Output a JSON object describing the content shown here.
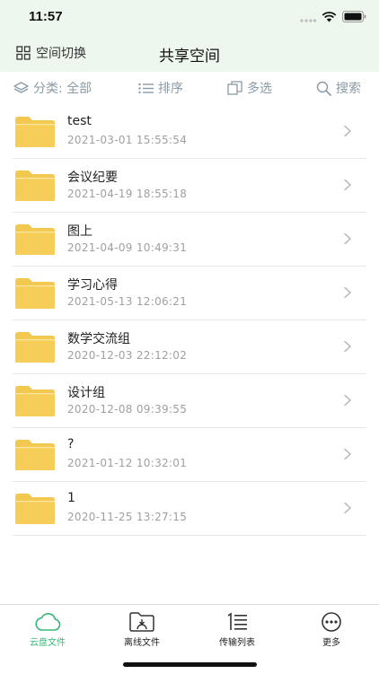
{
  "status": {
    "time": "11:57"
  },
  "nav": {
    "space_switch_label": "空间切换",
    "title": "共享空间"
  },
  "toolbar": {
    "category_label": "分类: 全部",
    "sort_label": "排序",
    "multi_select_label": "多选",
    "search_label": "搜索"
  },
  "files": [
    {
      "name": "test",
      "date": "2021-03-01 15:55:54"
    },
    {
      "name": "会议纪要",
      "date": "2021-04-19 18:55:18"
    },
    {
      "name": "图上",
      "date": "2021-04-09 10:49:31"
    },
    {
      "name": "学习心得",
      "date": "2021-05-13 12:06:21"
    },
    {
      "name": "数学交流组",
      "date": "2020-12-03 22:12:02"
    },
    {
      "name": "设计组",
      "date": "2020-12-08 09:39:55"
    },
    {
      "name": "?",
      "date": "2021-01-12 10:32:01"
    },
    {
      "name": "1",
      "date": "2020-11-25 13:27:15"
    }
  ],
  "tabs": [
    {
      "label": "云盘文件",
      "icon": "cloud-icon",
      "active": true
    },
    {
      "label": "离线文件",
      "icon": "offline-folder-icon",
      "active": false
    },
    {
      "label": "传输列表",
      "icon": "transfer-list-icon",
      "active": false
    },
    {
      "label": "更多",
      "icon": "more-icon",
      "active": false
    }
  ],
  "colors": {
    "header_bg": "#eef7ee",
    "accent": "#3ab77a",
    "folder": "#f3c84f",
    "toolbar_text": "#8a9aa5"
  }
}
